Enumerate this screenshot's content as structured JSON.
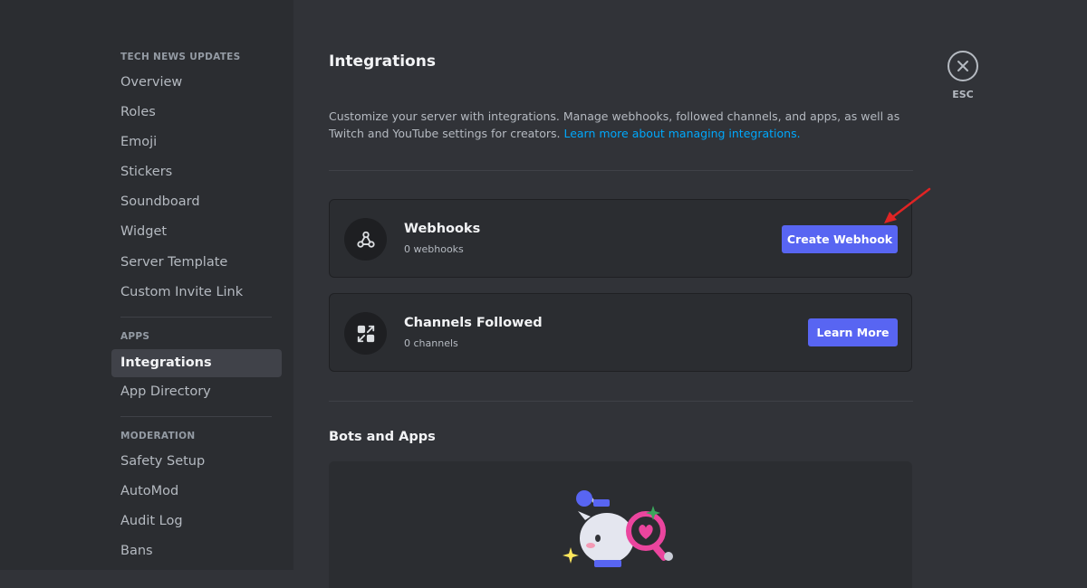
{
  "sidebar": {
    "server_section": "TECH NEWS UPDATES",
    "server_items": [
      {
        "label": "Overview"
      },
      {
        "label": "Roles"
      },
      {
        "label": "Emoji"
      },
      {
        "label": "Stickers"
      },
      {
        "label": "Soundboard"
      },
      {
        "label": "Widget"
      },
      {
        "label": "Server Template"
      },
      {
        "label": "Custom Invite Link"
      }
    ],
    "apps_section": "APPS",
    "apps_items": [
      {
        "label": "Integrations",
        "active": true
      },
      {
        "label": "App Directory"
      }
    ],
    "moderation_section": "MODERATION",
    "moderation_items": [
      {
        "label": "Safety Setup"
      },
      {
        "label": "AutoMod"
      },
      {
        "label": "Audit Log"
      },
      {
        "label": "Bans"
      }
    ]
  },
  "main": {
    "title": "Integrations",
    "description": "Customize your server with integrations. Manage webhooks, followed channels, and apps, as well as Twitch and YouTube settings for creators. ",
    "description_link": "Learn more about managing integrations.",
    "cards": [
      {
        "title": "Webhooks",
        "subtitle": "0 webhooks",
        "button": "Create Webhook",
        "icon": "webhook-icon"
      },
      {
        "title": "Channels Followed",
        "subtitle": "0 channels",
        "button": "Learn More",
        "icon": "channels-followed-icon"
      }
    ],
    "bots_title": "Bots and Apps"
  },
  "close": {
    "label": "ESC",
    "icon": "close-icon"
  },
  "colors": {
    "background": "#313338",
    "sidebar": "#2b2d31",
    "card": "#2b2d31",
    "button": "#5865f2",
    "link": "#00a8fc",
    "annotation_arrow": "#e02424"
  }
}
